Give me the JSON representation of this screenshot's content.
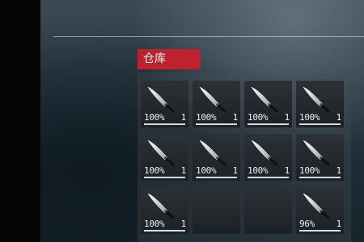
{
  "inventory": {
    "title": "仓库",
    "accent_color": "#c0212e",
    "slots": [
      {
        "item": "knife-icon",
        "durability": "100%",
        "count": "1"
      },
      {
        "item": "knife-icon",
        "durability": "100%",
        "count": "1"
      },
      {
        "item": "knife-icon",
        "durability": "100%",
        "count": "1"
      },
      {
        "item": "knife-icon",
        "durability": "100%",
        "count": "1"
      },
      {
        "item": "knife-icon",
        "durability": "100%",
        "count": "1"
      },
      {
        "item": "knife-icon",
        "durability": "100%",
        "count": "1"
      },
      {
        "item": "knife-icon",
        "durability": "100%",
        "count": "1"
      },
      {
        "item": "knife-icon",
        "durability": "100%",
        "count": "1"
      },
      {
        "item": "knife-icon",
        "durability": "100%",
        "count": "1"
      },
      {
        "item": null
      },
      {
        "item": null
      },
      {
        "item": "knife-icon",
        "durability": "96%",
        "count": "1"
      }
    ]
  }
}
